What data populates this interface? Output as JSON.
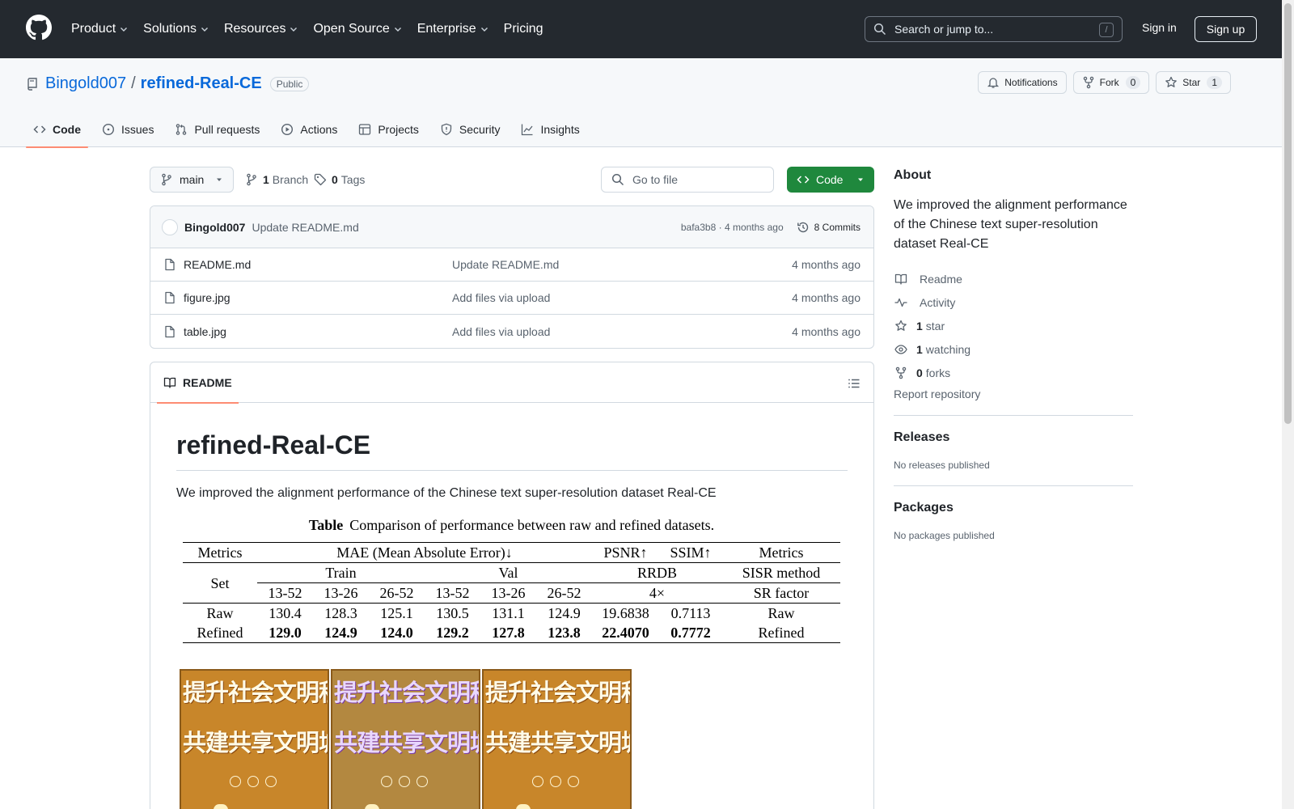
{
  "header": {
    "nav": [
      {
        "label": "Product",
        "has_menu": true
      },
      {
        "label": "Solutions",
        "has_menu": true
      },
      {
        "label": "Resources",
        "has_menu": true
      },
      {
        "label": "Open Source",
        "has_menu": true
      },
      {
        "label": "Enterprise",
        "has_menu": true
      },
      {
        "label": "Pricing",
        "has_menu": false
      }
    ],
    "search_placeholder": "Search or jump to...",
    "search_shortcut": "/",
    "sign_in": "Sign in",
    "sign_up": "Sign up"
  },
  "repo": {
    "owner": "Bingold007",
    "separator": "/",
    "name": "refined-Real-CE",
    "visibility": "Public",
    "notifications_label": "Notifications",
    "fork_label": "Fork",
    "fork_count": "0",
    "star_label": "Star",
    "star_count": "1",
    "tabs": [
      {
        "label": "Code",
        "icon": "code-icon",
        "active": true
      },
      {
        "label": "Issues",
        "icon": "issue-icon",
        "active": false
      },
      {
        "label": "Pull requests",
        "icon": "pull-request-icon",
        "active": false
      },
      {
        "label": "Actions",
        "icon": "play-icon",
        "active": false
      },
      {
        "label": "Projects",
        "icon": "table-icon",
        "active": false
      },
      {
        "label": "Security",
        "icon": "shield-icon",
        "active": false
      },
      {
        "label": "Insights",
        "icon": "graph-icon",
        "active": false
      }
    ]
  },
  "filenav": {
    "branch": "main",
    "branch_count": "1",
    "branch_label": "Branch",
    "tag_count": "0",
    "tag_label": "Tags",
    "goto_placeholder": "Go to file",
    "code_button": "Code"
  },
  "latest_commit": {
    "author": "Bingold007",
    "message": "Update README.md",
    "hash": "bafa3b8",
    "meta_sep": " · ",
    "age": "4 months ago",
    "commits_label": "8 Commits"
  },
  "files": [
    {
      "name": "README.md",
      "message": "Update README.md",
      "age": "4 months ago"
    },
    {
      "name": "figure.jpg",
      "message": "Add files via upload",
      "age": "4 months ago"
    },
    {
      "name": "table.jpg",
      "message": "Add files via upload",
      "age": "4 months ago"
    }
  ],
  "readme": {
    "tab_label": "README",
    "title": "refined-Real-CE",
    "description": "We improved the alignment performance of the Chinese text super-resolution dataset Real-CE",
    "table": {
      "caption_bold": "Table",
      "caption": "Comparison of performance between raw and refined datasets.",
      "h1": [
        "Metrics",
        "MAE (Mean Absolute Error)↓",
        "PSNR↑",
        "SSIM↑",
        "Metrics"
      ],
      "h2": [
        "Set",
        "Train",
        "Val",
        "RRDB",
        "SISR method"
      ],
      "h3": [
        "13-52",
        "13-26",
        "26-52",
        "13-52",
        "13-26",
        "26-52",
        "4×",
        "SR factor"
      ],
      "rows": [
        [
          "Raw",
          "130.4",
          "128.3",
          "125.1",
          "130.5",
          "131.1",
          "124.9",
          "19.6838",
          "0.7113",
          "Raw"
        ],
        [
          "Refined",
          "129.0",
          "124.9",
          "124.0",
          "129.2",
          "127.8",
          "123.8",
          "22.4070",
          "0.7772",
          "Refined"
        ]
      ]
    },
    "figure": {
      "line1": "提升社会文明程度",
      "line2": "共建共享文明城市"
    }
  },
  "sidebar": {
    "about_title": "About",
    "about_desc": "We improved the alignment performance of the Chinese text super-resolution dataset Real-CE",
    "links": [
      {
        "icon": "book-icon",
        "count": "",
        "label": "Readme"
      },
      {
        "icon": "pulse-icon",
        "count": "",
        "label": "Activity"
      },
      {
        "icon": "star-icon",
        "count": "1",
        "label": "star"
      },
      {
        "icon": "eye-icon",
        "count": "1",
        "label": "watching"
      },
      {
        "icon": "fork-icon",
        "count": "0",
        "label": "forks"
      }
    ],
    "report": "Report repository",
    "releases_title": "Releases",
    "releases_empty": "No releases published",
    "packages_title": "Packages",
    "packages_empty": "No packages published"
  },
  "colors": {
    "header_bg": "#24292f",
    "link_blue": "#0969da",
    "green_button": "#1f883d",
    "tab_underline": "#fd8c73"
  }
}
